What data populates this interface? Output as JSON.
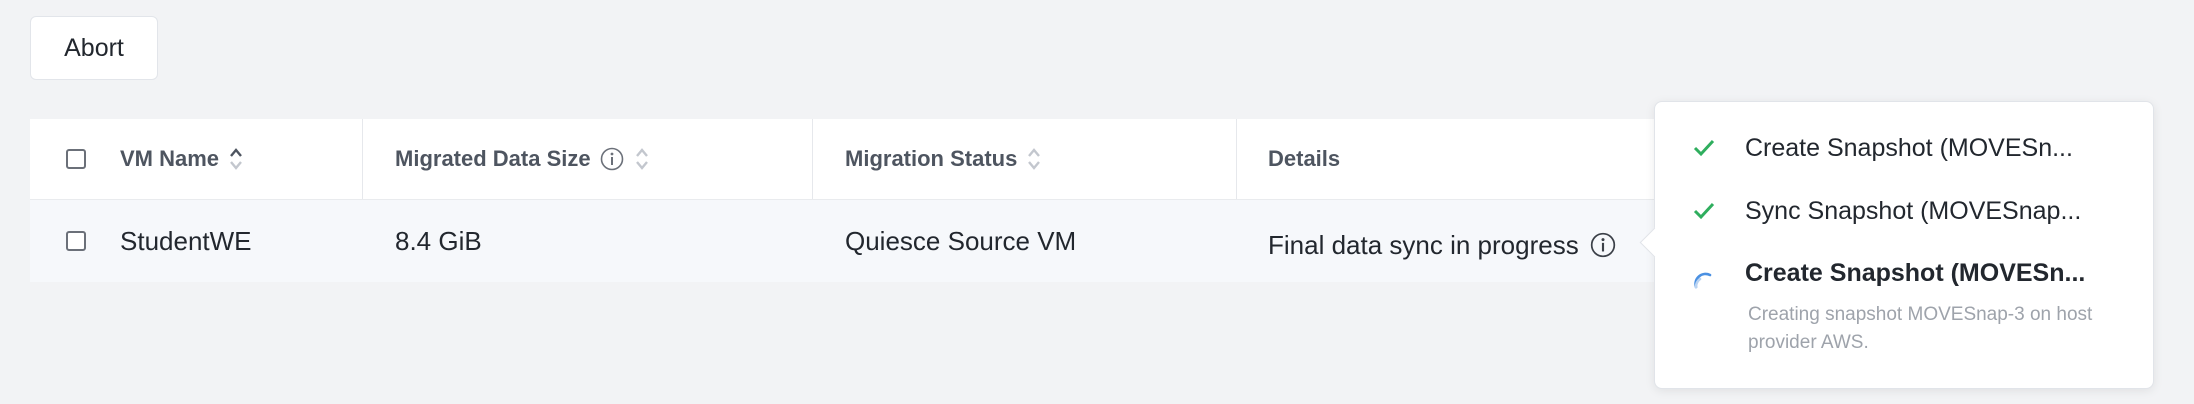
{
  "toolbar": {
    "abort_label": "Abort"
  },
  "table": {
    "columns": {
      "vm_name": "VM Name",
      "migrated_size": "Migrated Data Size",
      "migration_status": "Migration Status",
      "details": "Details"
    },
    "rows": [
      {
        "vm_name": "StudentWE",
        "migrated_size": "8.4 GiB",
        "migration_status": "Quiesce Source VM",
        "details": "Final data sync in progress"
      }
    ]
  },
  "popover": {
    "steps": [
      {
        "title": "Create Snapshot (MOVESn...",
        "state": "done"
      },
      {
        "title": "Sync Snapshot (MOVESnap...",
        "state": "done"
      },
      {
        "title": "Create Snapshot (MOVESn...",
        "state": "in-progress",
        "description": "Creating snapshot MOVESnap-3 on host provider AWS."
      }
    ]
  },
  "colors": {
    "success": "#2fae5e",
    "spinner": "#4a90e2",
    "background": "#f2f3f5"
  }
}
